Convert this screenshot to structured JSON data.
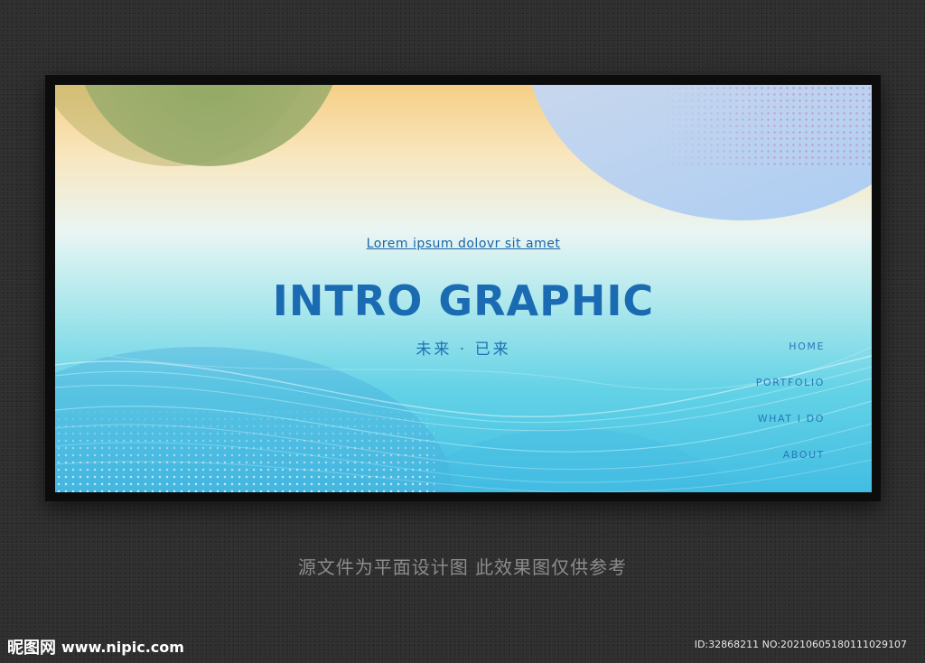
{
  "banner": {
    "subtitle": "Lorem ipsum dolovr sit amet",
    "title": "INTRO GRAPHIC",
    "tagline": "未来 · 已来",
    "nav": [
      {
        "label": "HOME"
      },
      {
        "label": "PORTFOLIO"
      },
      {
        "label": "WHAT I DO"
      },
      {
        "label": "ABOUT"
      }
    ]
  },
  "caption": "源文件为平面设计图 此效果图仅供参考",
  "watermark": {
    "logo_text": "昵图网",
    "url": "www.nipic.com",
    "id_text": "ID:32868211 NO:20210605180111029107"
  },
  "colors": {
    "background": "#2e2e2e",
    "accent": "#1a6bb2",
    "frame": "#0c0c0c"
  }
}
